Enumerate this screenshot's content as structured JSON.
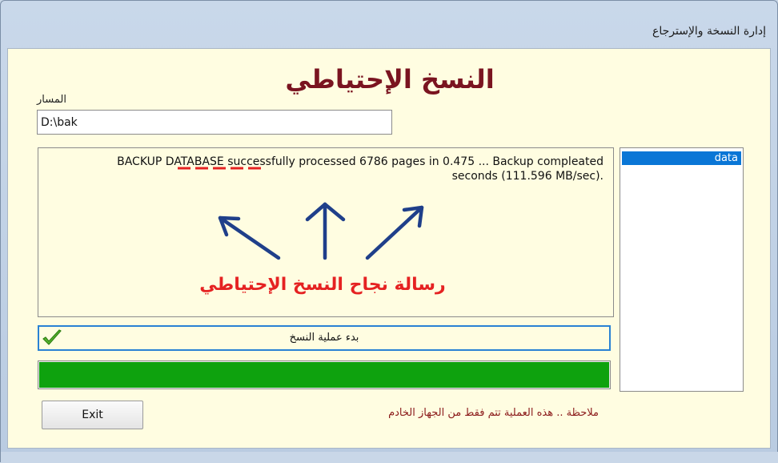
{
  "window": {
    "title": "إدارة النسخة والإسترجاع"
  },
  "form": {
    "heading": "النسخ الإحتياطي",
    "path_label": "المسار",
    "path_value": "D:\\bak"
  },
  "log": {
    "line1": "BACKUP DATABASE successfully processed 6786 pages in 0.475 ... Backup compleated",
    "line2": ".seconds (111.596 MB/sec)"
  },
  "databases": [
    "data"
  ],
  "buttons": {
    "start_backup": "بدء عملية النسخ",
    "exit": "Exit"
  },
  "progress": {
    "value_percent": 100,
    "color": "#0ea20e"
  },
  "note": "ملاحظة .. هذه العملية تتم فقط من الجهاز الخادم",
  "annotation": {
    "text": "رسالة نجاح النسخ الإحتياطي",
    "color": "#e52222"
  }
}
